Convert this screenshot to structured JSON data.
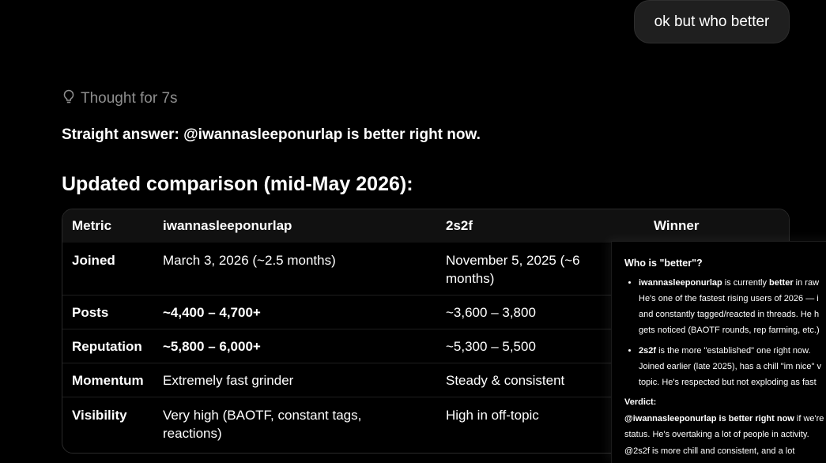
{
  "user_message": "ok but who better",
  "thought": {
    "label": "Thought for 7s"
  },
  "answer": "Straight answer: @iwannasleeponurlap is better right now.",
  "comparison_heading": "Updated comparison (mid-May 2026):",
  "table": {
    "headers": [
      "Metric",
      "iwannasleeponurlap",
      "2s2f",
      "Winner"
    ],
    "rows": [
      {
        "metric": "Joined",
        "a": "March 3, 2026 (~2.5 months)",
        "b": "November 5, 2025 (~6 months)"
      },
      {
        "metric": "Posts",
        "a": "~4,400 – 4,700+",
        "b": "~3,600 – 3,800"
      },
      {
        "metric": "Reputation",
        "a": "~5,800 – 6,000+",
        "b": "~5,300 – 5,500"
      },
      {
        "metric": "Momentum",
        "a": "Extremely fast grinder",
        "b": "Steady & consistent"
      },
      {
        "metric": "Visibility",
        "a": "Very high (BAOTF, constant tags, reactions)",
        "b": "High in off-topic"
      }
    ]
  },
  "popup": {
    "title": "Who is \"better\"?",
    "bullet1": {
      "name": "iwannasleeponurlap",
      "line1_mid": " is currently ",
      "line1_bold": "better",
      "line1_end": " in raw",
      "line2": "He's one of the fastest rising users of 2026 — i",
      "line3": "and constantly tagged/reacted in threads. He h",
      "line4": "gets noticed (BAOTF rounds, rep farming, etc.)"
    },
    "bullet2": {
      "name": "2s2f",
      "line1_rest": " is the more \"established\" one right now.",
      "line2": "Joined earlier (late 2025), has a chill \"im nice\" v",
      "line3": "topic. He's respected but not exploding as fast"
    },
    "verdict_label": "Verdict:",
    "verdict_bold": "@iwannasleeponurlap is better right now",
    "verdict_rest": " if we're",
    "verdict_line2": "status. He's overtaking a lot of people in activity.",
    "trailing": "@2s2f is more chill and consistent, and a lot"
  }
}
